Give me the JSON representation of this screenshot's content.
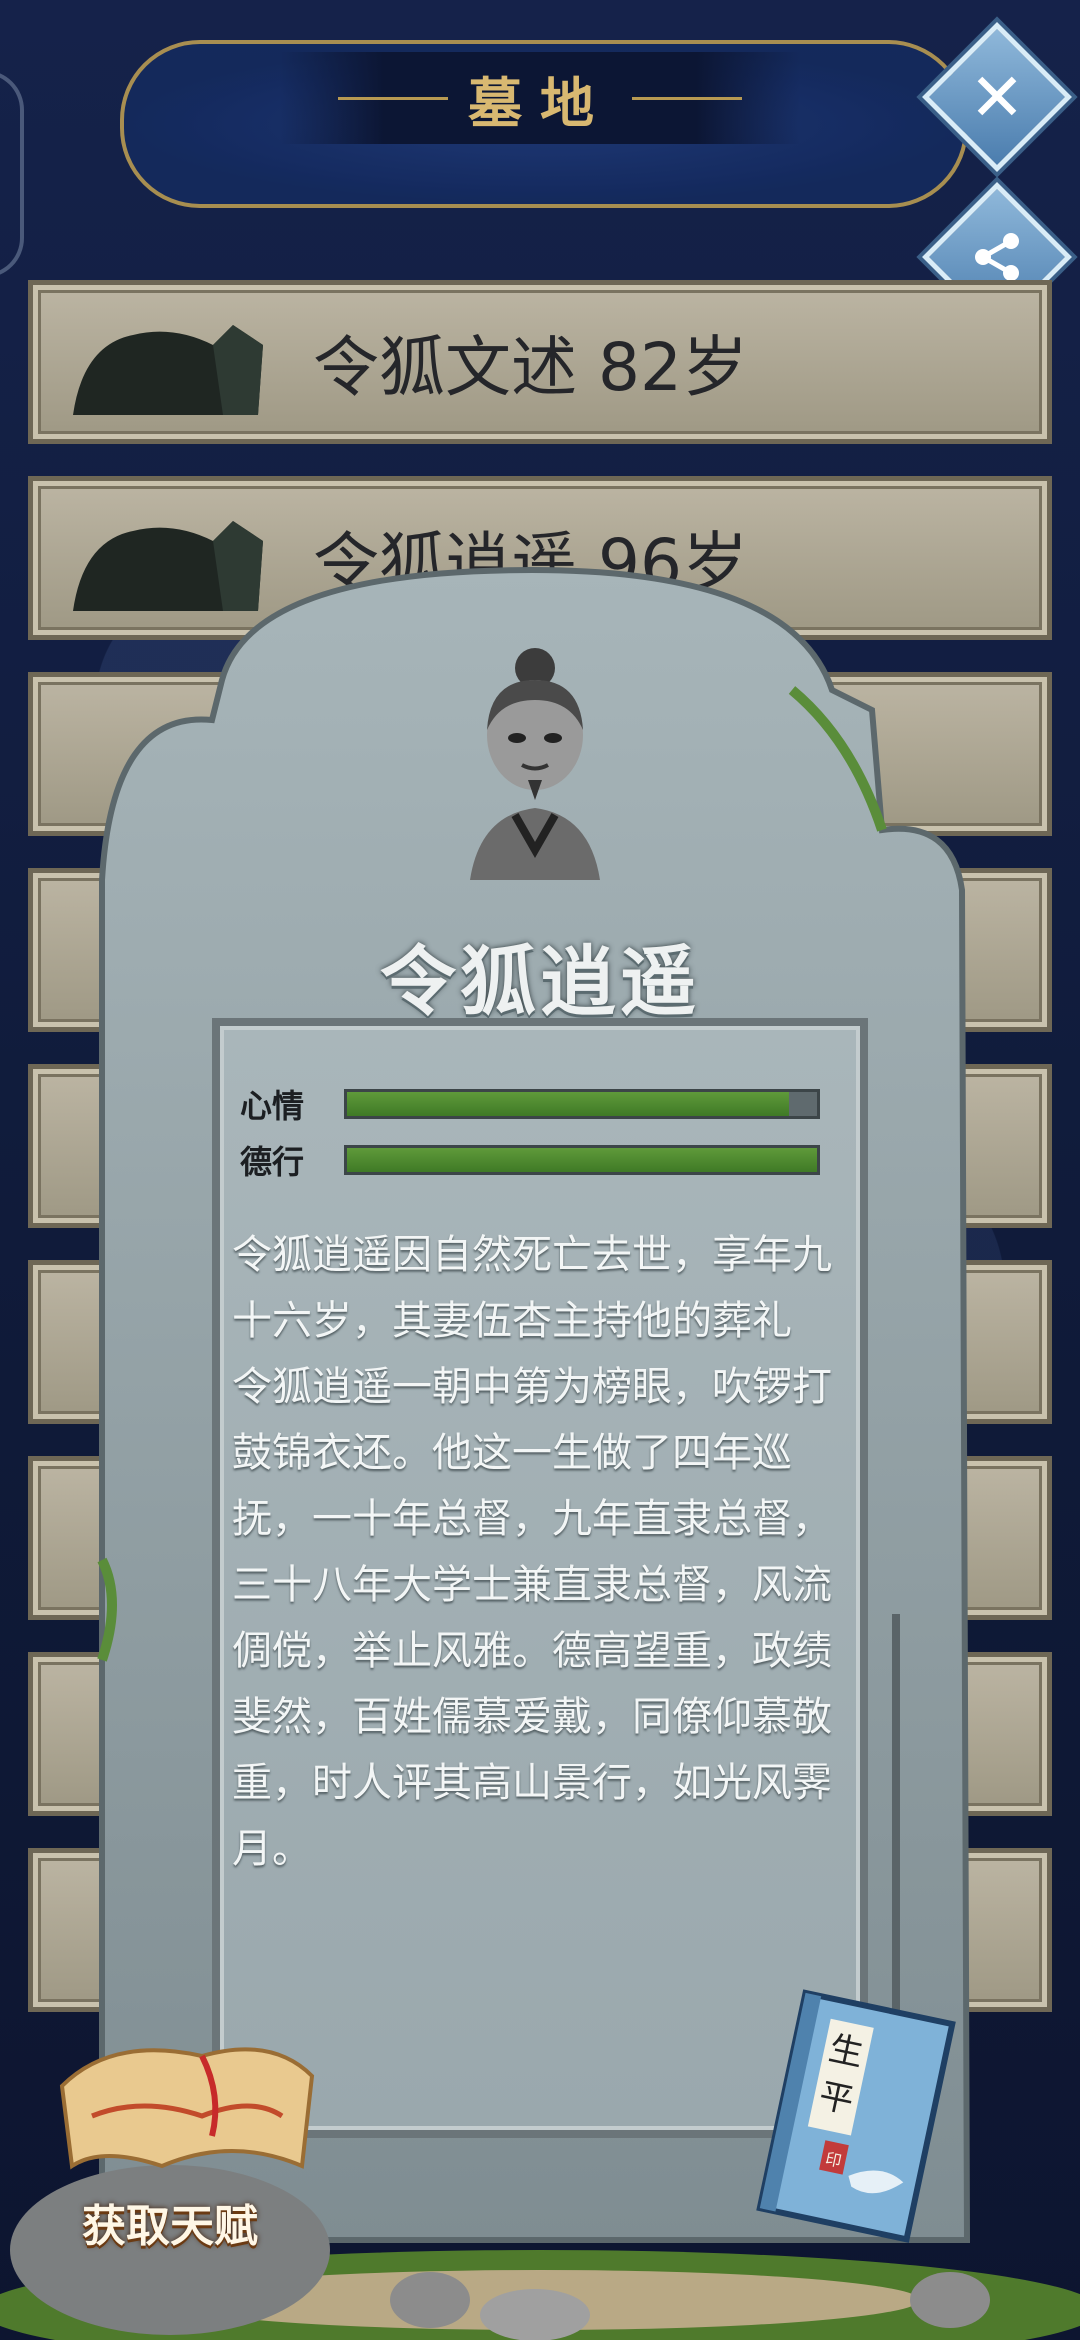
{
  "header": {
    "title": "墓地"
  },
  "actions": {
    "close_icon": "close-icon",
    "share_icon": "share-icon"
  },
  "graves": [
    {
      "label": "令狐文述 82岁"
    },
    {
      "label": "令狐逍遥 96岁"
    }
  ],
  "tombstone": {
    "name": "令狐逍遥",
    "stats": [
      {
        "label": "心情",
        "value": 0.94
      },
      {
        "label": "德行",
        "value": 1.0
      }
    ],
    "description": [
      "令狐逍遥因自然死亡去世，享年九十六岁，其妻伍杏主持他的葬礼",
      "令狐逍遥一朝中第为榜眼，吹锣打鼓锦衣还。他这一生做了四年巡抚，一十年总督，九年直隶总督，三十八年大学士兼直隶总督，风流倜傥，举止风雅。德高望重，政绩斐然，百姓儒慕爱戴，同僚仰慕敬重，时人评其高山景行，如光风霁月。"
    ]
  },
  "footer": {
    "talent_button": "获取天赋",
    "biography_book_title": "生平",
    "stamp_text": "印"
  },
  "colors": {
    "bar_fill": "#4f8a30",
    "gold": "#d8b871",
    "stone": "#9aa8ad"
  }
}
